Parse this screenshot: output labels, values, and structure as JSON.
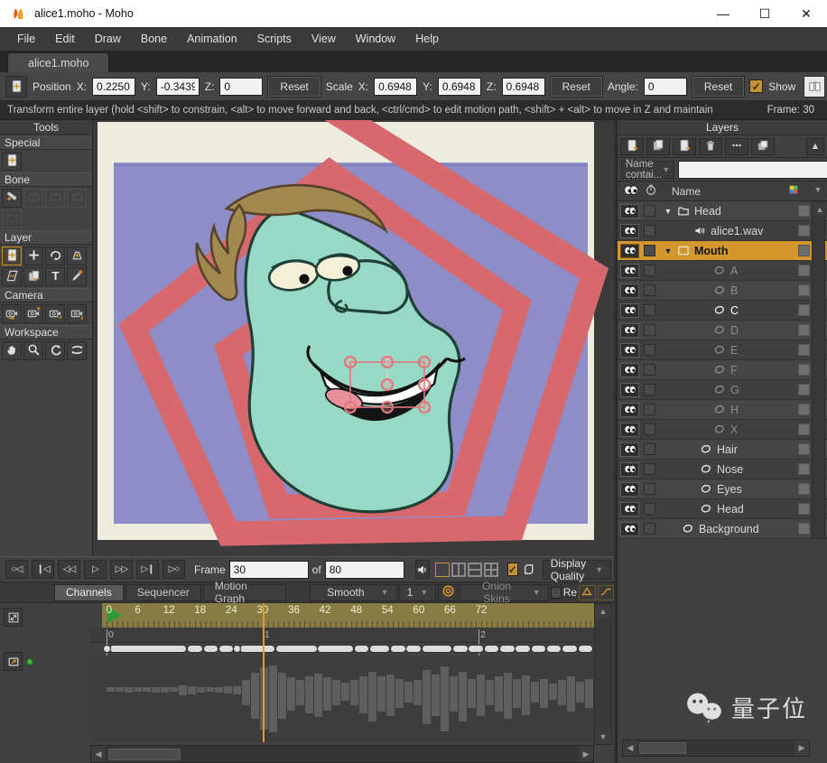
{
  "window": {
    "title": "alice1.moho - Moho",
    "minimize": "—",
    "maximize": "☐",
    "close": "✕"
  },
  "menu": {
    "items": [
      "File",
      "Edit",
      "Draw",
      "Bone",
      "Animation",
      "Scripts",
      "View",
      "Window",
      "Help"
    ]
  },
  "tabs": {
    "active": "alice1.moho"
  },
  "toolbar": {
    "position_label": "Position",
    "x_label": "X:",
    "y_label": "Y:",
    "z_label": "Z:",
    "position": {
      "x": "0.2250",
      "y": "-0.3439",
      "z": "0"
    },
    "reset_label": "Reset",
    "scale_label": "Scale",
    "scale": {
      "x": "0.6948",
      "y": "0.6948",
      "z": "0.6948"
    },
    "angle_label": "Angle:",
    "angle": "0",
    "show_label": "Show"
  },
  "status_bar": {
    "message": "Transform entire layer (hold <shift> to constrain, <alt> to move forward and back, <ctrl/cmd> to edit motion path, <shift> + <alt> to move in Z and maintain",
    "frame_indicator": "Frame: 30"
  },
  "tools_panel": {
    "title": "Tools",
    "sections": [
      {
        "label": "Special",
        "tools": [
          {
            "icon": "transform-layer"
          }
        ]
      },
      {
        "label": "Bone",
        "tools": [
          {
            "icon": "select-bone"
          },
          {
            "icon": "bone-tool-disabled",
            "disabled": true
          },
          {
            "icon": "bone-tool-disabled",
            "disabled": true
          },
          {
            "icon": "bone-tool-disabled",
            "disabled": true
          },
          {
            "icon": "bone-tool-disabled",
            "disabled": true
          }
        ]
      },
      {
        "label": "Layer",
        "tools": [
          {
            "icon": "transform-layer",
            "selected": true
          },
          {
            "icon": "add-point"
          },
          {
            "icon": "rotate-layer"
          },
          {
            "icon": "set-origin"
          },
          {
            "icon": "shear-layer"
          },
          {
            "icon": "follow-path"
          },
          {
            "icon": "insert-text"
          },
          {
            "icon": "eyedropper"
          }
        ]
      },
      {
        "label": "Camera",
        "tools": [
          {
            "icon": "track-camera"
          },
          {
            "icon": "zoom-camera"
          },
          {
            "icon": "roll-camera"
          },
          {
            "icon": "pan-tilt-camera"
          }
        ]
      },
      {
        "label": "Workspace",
        "tools": [
          {
            "icon": "pan-workspace"
          },
          {
            "icon": "zoom-workspace"
          },
          {
            "icon": "rotate-workspace"
          },
          {
            "icon": "orbit-workspace"
          }
        ]
      }
    ]
  },
  "layers_panel": {
    "title": "Layers",
    "filter_label": "Name contai...",
    "search_value": "",
    "name_column": "Name",
    "rows": [
      {
        "name": "Head",
        "icon": "folder",
        "pad": 8,
        "caret": true
      },
      {
        "name": "alice1.wav",
        "icon": "audio",
        "pad": 38
      },
      {
        "name": "Mouth",
        "icon": "switch-layer",
        "pad": 8,
        "caret": true,
        "selected": true
      },
      {
        "name": "A",
        "icon": "vector-layer",
        "pad": 60,
        "dim": true
      },
      {
        "name": "B",
        "icon": "vector-layer",
        "pad": 60,
        "dim": true
      },
      {
        "name": "C",
        "icon": "vector-layer",
        "pad": 60,
        "bright": true
      },
      {
        "name": "D",
        "icon": "vector-layer",
        "pad": 60,
        "dim": true
      },
      {
        "name": "E",
        "icon": "vector-layer",
        "pad": 60,
        "dim": true
      },
      {
        "name": "F",
        "icon": "vector-layer",
        "pad": 60,
        "dim": true
      },
      {
        "name": "G",
        "icon": "vector-layer",
        "pad": 60,
        "dim": true
      },
      {
        "name": "H",
        "icon": "vector-layer",
        "pad": 60,
        "dim": true
      },
      {
        "name": "X",
        "icon": "vector-layer",
        "pad": 60,
        "dim": true
      },
      {
        "name": "Hair",
        "icon": "vector-layer",
        "pad": 45
      },
      {
        "name": "Nose",
        "icon": "vector-layer",
        "pad": 45
      },
      {
        "name": "Eyes",
        "icon": "vector-layer",
        "pad": 45
      },
      {
        "name": "Head",
        "icon": "vector-layer",
        "pad": 45
      },
      {
        "name": "Background",
        "icon": "vector-layer",
        "pad": 25
      }
    ]
  },
  "playback": {
    "buttons": [
      "play-from-start",
      "go-to-start",
      "step-back",
      "play",
      "step-forward",
      "go-to-end",
      "play-to-end"
    ],
    "frame_label": "Frame",
    "frame_value": "30",
    "of_label": "of",
    "total_value": "80",
    "display_quality_label": "Display Quality"
  },
  "timeline": {
    "tabs": [
      "Channels",
      "Sequencer",
      "Motion Graph"
    ],
    "active_tab": "Channels",
    "interpolation_value": "Smooth",
    "multiplier_value": "1",
    "onion_label": "Onion Skins",
    "relative_label": "Re",
    "current_frame": 30,
    "ruler_ticks": [
      0,
      6,
      12,
      18,
      24,
      30,
      36,
      42,
      48,
      54,
      60,
      66,
      72
    ],
    "seconds_markers": [
      {
        "label": "0",
        "frame": 0
      },
      {
        "label": "1",
        "frame": 30
      },
      {
        "label": "2",
        "frame": 71.5
      }
    ],
    "keyframes": {
      "dots": [
        0,
        25
      ],
      "segments": [
        [
          1,
          15
        ],
        [
          16,
          18
        ],
        [
          19,
          21
        ],
        [
          22,
          24
        ],
        [
          26,
          32
        ],
        [
          33,
          40
        ],
        [
          41,
          47
        ],
        [
          48,
          50
        ],
        [
          51,
          54
        ],
        [
          55,
          57
        ],
        [
          58,
          60
        ],
        [
          61,
          66
        ],
        [
          67,
          69
        ],
        [
          70,
          72
        ],
        [
          73,
          75
        ],
        [
          76,
          78
        ],
        [
          79,
          81
        ],
        [
          82,
          84
        ],
        [
          85,
          87
        ],
        [
          88,
          90
        ],
        [
          91,
          93
        ]
      ]
    },
    "waveform": [
      0.05,
      0.05,
      0.06,
      0.05,
      0.05,
      0.07,
      0.06,
      0.05,
      0.12,
      0.1,
      0.06,
      0.05,
      0.06,
      0.08,
      0.1,
      0.3,
      0.55,
      0.75,
      0.8,
      0.55,
      0.4,
      0.3,
      0.45,
      0.52,
      0.4,
      0.3,
      0.22,
      0.3,
      0.45,
      0.6,
      0.42,
      0.5,
      0.35,
      0.25,
      0.3,
      0.65,
      0.5,
      0.78,
      0.42,
      0.6,
      0.35,
      0.5,
      0.3,
      0.42,
      0.55,
      0.35,
      0.48,
      0.25,
      0.35,
      0.2,
      0.3,
      0.42,
      0.25,
      0.35
    ]
  },
  "canvas": {
    "colors": {
      "workspace": "#3a3a3a",
      "page": "#edecdf",
      "frame_rect": "#8e8dc7",
      "spiral": "#d7686e",
      "skin": "#98d9c6",
      "outline": "#1f4036",
      "hair": "#a1894f",
      "hair_outline": "#55422a",
      "eye": "#f4f0d8",
      "mouth_dark": "#141414",
      "tongue": "#e8919c",
      "selection": "#e0787d"
    }
  },
  "watermark": {
    "text": "量子位"
  },
  "theme": {
    "accent_orange": "#d0942c",
    "selected_row": "#d3972e",
    "ruler": "#867c44"
  }
}
